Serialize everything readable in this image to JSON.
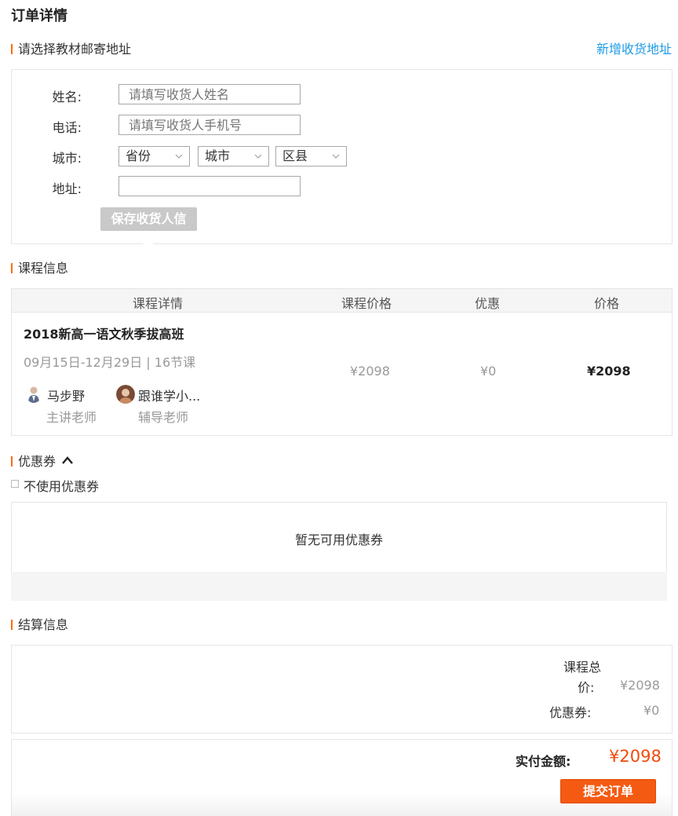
{
  "page": {
    "title": "订单详情"
  },
  "address": {
    "section_title": "请选择教材邮寄地址",
    "new_address_link": "新增收货地址",
    "labels": {
      "name": "姓名:",
      "phone": "电话:",
      "city": "城市:",
      "address": "地址:"
    },
    "name_placeholder": "请填写收货人姓名",
    "phone_placeholder": "请填写收货人手机号",
    "address_value": "",
    "selects": {
      "province": "省份",
      "city": "城市",
      "district": "区县"
    },
    "save_button": "保存收货人信"
  },
  "course": {
    "section_title": "课程信息",
    "columns": [
      "课程详情",
      "课程价格",
      "优惠",
      "价格"
    ],
    "name": "2018新高一语文秋季拔高班",
    "schedule": "09月15日-12月29日 | 16节课",
    "teachers": [
      {
        "name": "马步野",
        "role": "主讲老师"
      },
      {
        "name": "跟谁学小...",
        "role": "辅导老师"
      }
    ],
    "course_price": "¥2098",
    "discount": "¥0",
    "price": "¥2098"
  },
  "coupon": {
    "section_title": "优惠券",
    "no_use_label": "不使用优惠券",
    "empty_text": "暂无可用优惠券"
  },
  "settlement": {
    "section_title": "结算信息",
    "total_label_line1": "课程总",
    "total_label_line2": "价:",
    "total_value": "¥2098",
    "coupon_label": "优惠券:",
    "coupon_value": "¥0",
    "paid_label": "实付金额:",
    "paid_value": "¥2098",
    "submit_button": "提交订单"
  },
  "colors": {
    "accent": "#ff6a00",
    "link": "#1e9be6",
    "submit": "#f55a12",
    "price_red": "#f44a0c"
  }
}
